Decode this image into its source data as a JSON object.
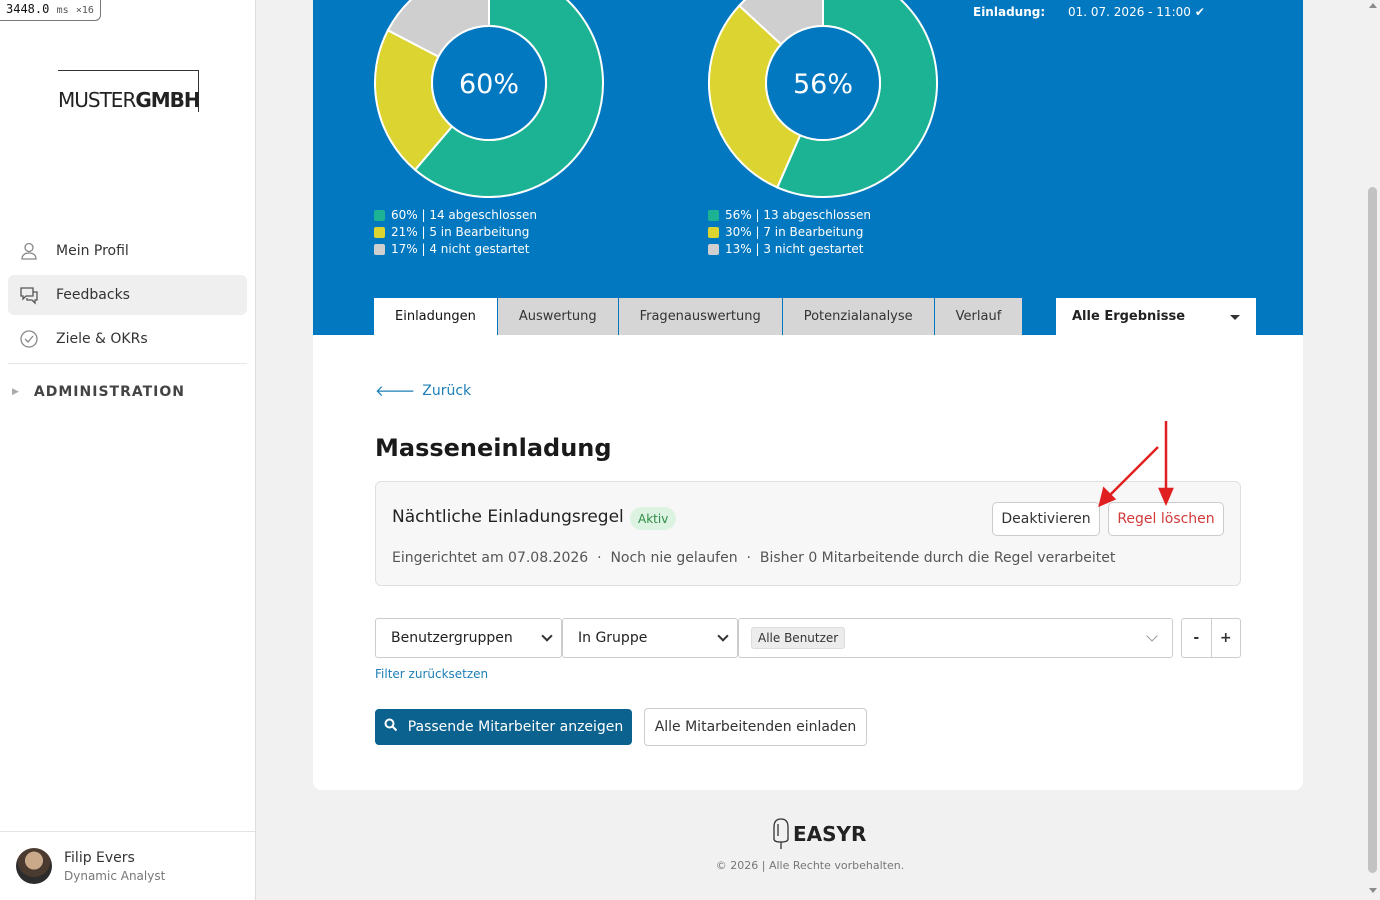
{
  "debug": {
    "value": "3448.0",
    "unit": "ms",
    "mult": "×16"
  },
  "brand": {
    "light": "MUSTER",
    "bold": "GMBH"
  },
  "nav": {
    "items": [
      {
        "label": "Mein Profil",
        "icon": "user-icon"
      },
      {
        "label": "Feedbacks",
        "icon": "chat-bubbles-icon",
        "active": true
      },
      {
        "label": "Ziele & OKRs",
        "icon": "check-circle-icon"
      }
    ],
    "admin": "ADMINISTRATION"
  },
  "user": {
    "name": "Filip Evers",
    "role": "Dynamic Analyst"
  },
  "colors": {
    "primary": "#0278c0",
    "done": "#1cb394",
    "progress": "#dcd431",
    "not_started": "#cfcfcf",
    "danger": "#d23a3a",
    "link": "#1d7fb6"
  },
  "charts": [
    {
      "center": "60%",
      "segments": [
        {
          "pct": 60,
          "color": "#1cb394",
          "label": "60% | 14 abgeschlossen"
        },
        {
          "pct": 21,
          "color": "#dcd431",
          "label": "21% | 5 in Bearbeitung"
        },
        {
          "pct": 17,
          "color": "#cfcfcf",
          "label": "17% | 4 nicht gestartet"
        }
      ]
    },
    {
      "center": "56%",
      "segments": [
        {
          "pct": 56,
          "color": "#1cb394",
          "label": "56% | 13 abgeschlossen"
        },
        {
          "pct": 30,
          "color": "#dcd431",
          "label": "30% | 7 in Bearbeitung"
        },
        {
          "pct": 13,
          "color": "#cfcfcf",
          "label": "13% | 3 nicht gestartet"
        }
      ]
    }
  ],
  "invitation": {
    "label": "Einladung:",
    "value": "01. 07. 2026 - 11:00"
  },
  "tabs": [
    "Einladungen",
    "Auswertung",
    "Fragenauswertung",
    "Potenzialanalyse",
    "Verlauf"
  ],
  "results_filter": "Alle Ergebnisse",
  "back": "Zurück",
  "page_title": "Masseneinladung",
  "rule": {
    "title": "Nächtliche Einladungsregel",
    "status": "Aktiv",
    "deactivate": "Deaktivieren",
    "delete": "Regel löschen",
    "meta": "Eingerichtet am 07.08.2026  ·  Noch nie gelaufen  ·  Bisher 0 Mitarbeitende durch die Regel verarbeitet"
  },
  "filter": {
    "field": "Benutzergruppen",
    "operator": "In Gruppe",
    "value_chip": "Alle Benutzer",
    "minus": "-",
    "plus": "+",
    "reset": "Filter zurücksetzen"
  },
  "actions": {
    "show": "Passende Mitarbeiter anzeigen",
    "invite_all": "Alle Mitarbeitenden einladen"
  },
  "footer": {
    "brand": "EASYR",
    "copy": "© 2026 | Alle Rechte vorbehalten."
  }
}
